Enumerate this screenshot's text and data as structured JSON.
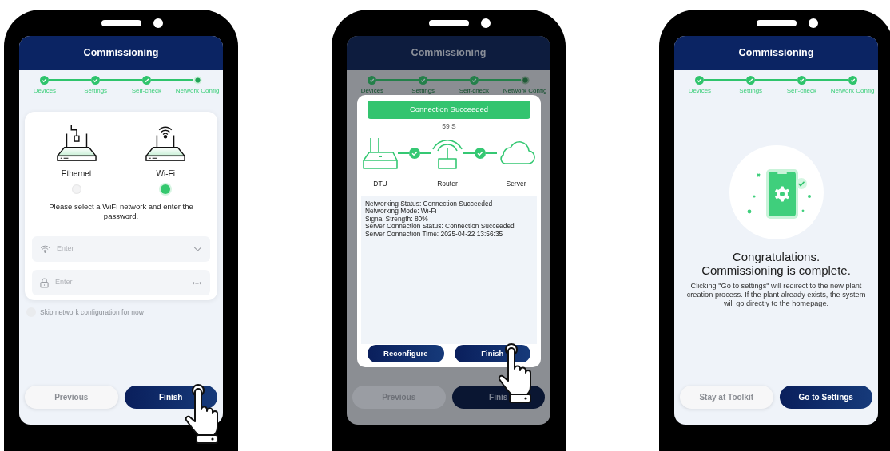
{
  "phones": [
    {
      "header": "Commissioning",
      "steps": [
        {
          "label": "Devices",
          "done": true
        },
        {
          "label": "Settings",
          "done": true
        },
        {
          "label": "Self-check",
          "done": true
        },
        {
          "label": "Network Config",
          "done": false
        }
      ],
      "connection_options": [
        {
          "kind": "ethernet",
          "label": "Ethernet",
          "selected": false
        },
        {
          "kind": "wifi",
          "label": "Wi-Fi",
          "selected": true
        }
      ],
      "instruction": "Please select a WiFi network and enter the password.",
      "fields": [
        {
          "kind": "network",
          "placeholder": "Enter"
        },
        {
          "kind": "password",
          "placeholder": "Enter"
        }
      ],
      "skip_option": {
        "label": "Skip network configuration for now",
        "checked": false
      },
      "buttons": [
        {
          "label": "Previous",
          "primary": false,
          "tapped": false
        },
        {
          "label": "Finish",
          "primary": true,
          "tapped": true
        }
      ]
    },
    {
      "header": "Commissioning",
      "steps": [
        {
          "label": "Devices",
          "done": true
        },
        {
          "label": "Settings",
          "done": true
        },
        {
          "label": "Self-check",
          "done": true
        },
        {
          "label": "Network Config",
          "done": false
        }
      ],
      "buttons": [
        {
          "label": "Previous",
          "primary": false,
          "tapped": false
        },
        {
          "label": "Finis",
          "primary": true,
          "tapped": false
        }
      ],
      "dialog": {
        "status": "Connection Succeeded",
        "countdown": "59 S",
        "nodes": [
          {
            "kind": "dtu",
            "label": "DTU"
          },
          {
            "kind": "router",
            "label": "Router"
          },
          {
            "kind": "server",
            "label": "Server"
          }
        ],
        "links": [
          {
            "ok": true
          },
          {
            "ok": true
          }
        ],
        "details": [
          "Networking Status: Connection Succeeded",
          "Networking Mode: Wi-Fi",
          "Signal Strength: 80%",
          "Server Connection Status: Connection Succeeded",
          "Server Connection Time: 2025-04-22 13:56:35"
        ],
        "buttons": [
          {
            "label": "Reconfigure",
            "primary": true,
            "tapped": false
          },
          {
            "label": "Finish",
            "primary": true,
            "tapped": true
          }
        ]
      }
    },
    {
      "header": "Commissioning",
      "steps": [
        {
          "label": "Devices",
          "done": true
        },
        {
          "label": "Settings",
          "done": true
        },
        {
          "label": "Self-check",
          "done": true
        },
        {
          "label": "Network Config",
          "done": true
        }
      ],
      "heading": "Congratulations. Commissioning is complete.",
      "message": "Clicking \"Go to settings\" will redirect to the new plant creation process. If the plant already exists, the system will go directly to the homepage.",
      "buttons": [
        {
          "label": "Stay at Toolkit",
          "primary": false,
          "tapped": false
        },
        {
          "label": "Go to Settings",
          "primary": true,
          "tapped": false
        }
      ]
    }
  ]
}
